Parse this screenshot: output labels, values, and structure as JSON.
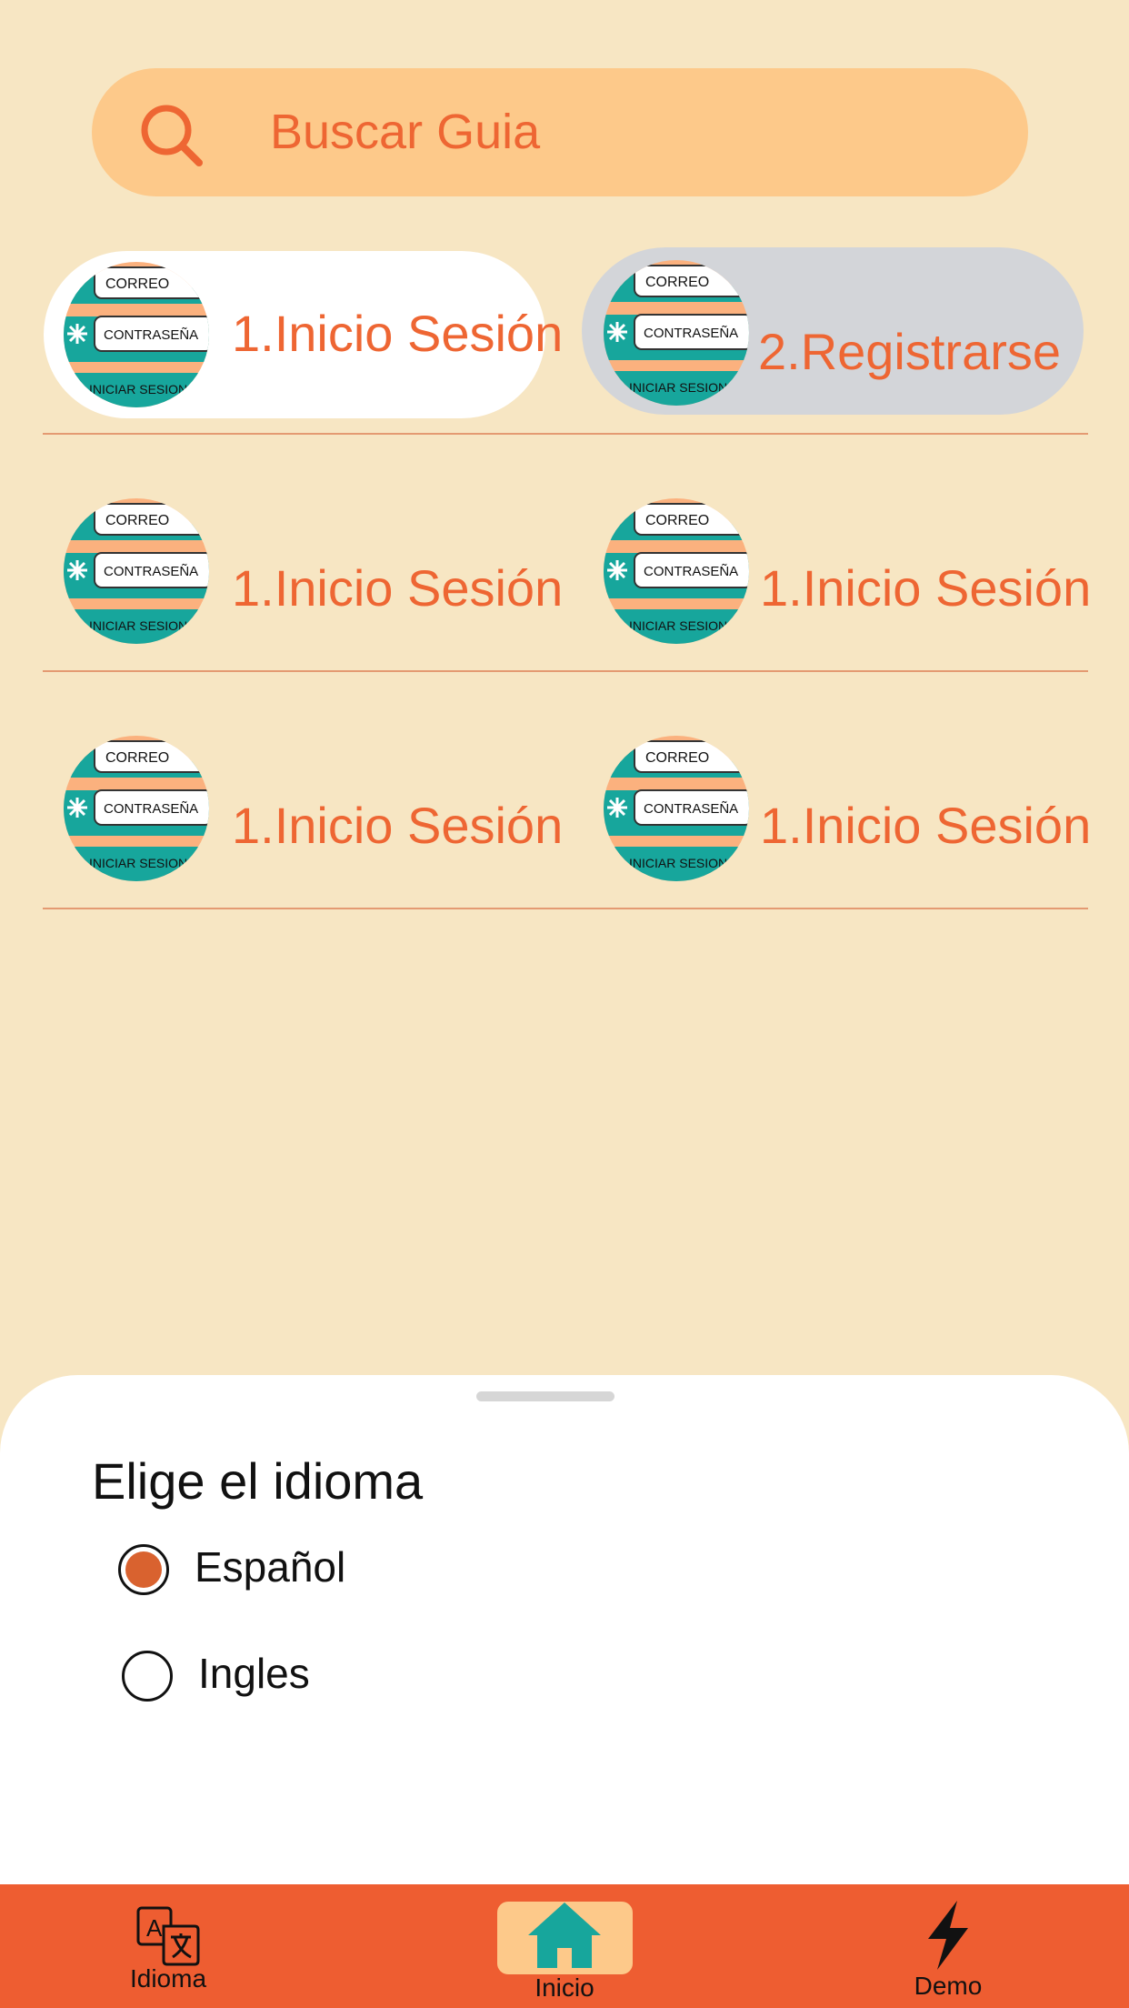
{
  "search": {
    "placeholder": "Buscar Guia",
    "icon": "search-icon"
  },
  "guides": [
    {
      "label": "1.Inicio Sesión",
      "state": "selected"
    },
    {
      "label": "2.Registrarse",
      "state": "highlighted"
    },
    {
      "label": "1.Inicio Sesión"
    },
    {
      "label": "1.Inicio Sesión"
    },
    {
      "label": "1.Inicio Sesión"
    },
    {
      "label": "1.Inicio Sesión"
    }
  ],
  "thumbnail": {
    "field1": "CORREO",
    "field2": "CONTRASEÑA",
    "button": "INICIAR SESION"
  },
  "language_sheet": {
    "title": "Elige el idioma",
    "options": [
      {
        "label": "Español",
        "selected": true
      },
      {
        "label": "Ingles",
        "selected": false
      }
    ]
  },
  "bottom_nav": [
    {
      "label": "Idioma",
      "icon": "translate-icon"
    },
    {
      "label": "Inicio",
      "icon": "home-icon",
      "active": true
    },
    {
      "label": "Demo",
      "icon": "lightning-icon"
    }
  ],
  "colors": {
    "background": "#f7e6c3",
    "accent": "#ee5d31",
    "search_bg": "#fdc98a",
    "teal": "#17a69c"
  }
}
